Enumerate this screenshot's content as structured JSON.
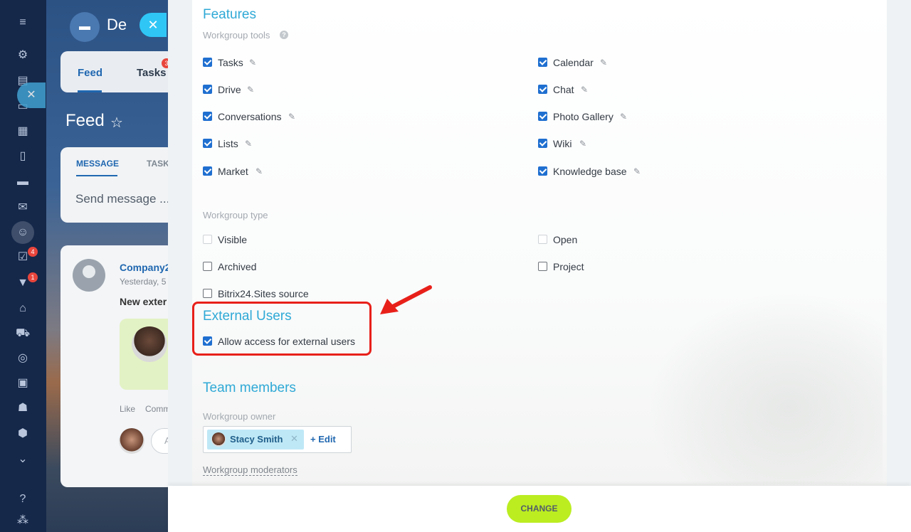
{
  "background": {
    "portal_name": "De",
    "tabs": [
      {
        "label": "Feed",
        "active": true
      },
      {
        "label": "Tasks",
        "badge": "3"
      }
    ],
    "page_title": "Feed",
    "composer": {
      "tab_message": "MESSAGE",
      "tab_task": "TASK",
      "placeholder": "Send message ..."
    },
    "post": {
      "author": "Company2",
      "time": "Yesterday, 5",
      "title": "New exter",
      "like": "Like",
      "comment": "Comm",
      "add_comment": "A"
    }
  },
  "leftnav": {
    "icons": [
      "menu-icon",
      "sites-icon",
      "chat-icon",
      "messenger-icon",
      "calendar-icon",
      "document-icon",
      "drive-icon",
      "mail-icon",
      "groups-icon",
      "tasks-icon",
      "crm-icon",
      "company-icon",
      "shop-icon",
      "target-icon",
      "contact-card-icon",
      "robot-icon",
      "box-icon",
      "more-icon",
      "help-icon",
      "sitemap-icon"
    ],
    "badges": {
      "tasks": "4",
      "crm": "1"
    }
  },
  "form": {
    "features": {
      "title": "Features",
      "subtitle": "Workgroup tools",
      "tools": [
        {
          "label": "Tasks",
          "checked": true
        },
        {
          "label": "Drive",
          "checked": true
        },
        {
          "label": "Conversations",
          "checked": true
        },
        {
          "label": "Lists",
          "checked": true
        },
        {
          "label": "Market",
          "checked": true
        },
        {
          "label": "Calendar",
          "checked": true
        },
        {
          "label": "Chat",
          "checked": true
        },
        {
          "label": "Photo Gallery",
          "checked": true
        },
        {
          "label": "Wiki",
          "checked": true
        },
        {
          "label": "Knowledge base",
          "checked": true
        }
      ]
    },
    "type": {
      "subtitle": "Workgroup type",
      "options": [
        {
          "label": "Visible",
          "checked": false,
          "disabled": true
        },
        {
          "label": "Archived",
          "checked": false
        },
        {
          "label": "Bitrix24.Sites source",
          "checked": false
        },
        {
          "label": "Open",
          "checked": false,
          "disabled": true
        },
        {
          "label": "Project",
          "checked": false
        }
      ]
    },
    "external": {
      "title": "External Users",
      "option": {
        "label": "Allow access for external users",
        "checked": true
      }
    },
    "team": {
      "title": "Team members",
      "owner_label": "Workgroup owner",
      "owner_name": "Stacy Smith",
      "edit_label": "+ Edit",
      "moderators_label": "Workgroup moderators"
    }
  },
  "footer": {
    "change_label": "CHANGE"
  },
  "colors": {
    "accent": "#2fa9d6",
    "checkbox": "#1f6fd0",
    "highlight": "#e8201a",
    "change_button": "#bbed21"
  }
}
